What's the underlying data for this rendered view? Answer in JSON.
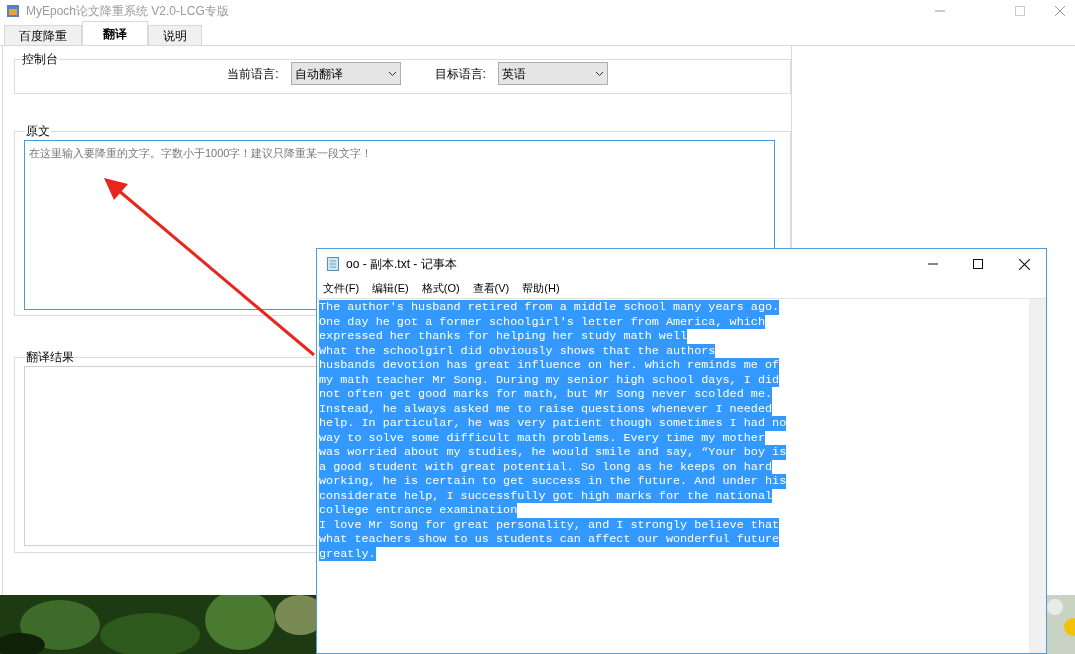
{
  "app_window": {
    "title": "MyEpoch论文降重系统 V2.0-LCG专版",
    "tabs": [
      {
        "label": "百度降重",
        "selected": false
      },
      {
        "label": "翻译",
        "selected": true
      },
      {
        "label": "说明",
        "selected": false
      }
    ],
    "console": {
      "title": "控制台",
      "source_language": {
        "label": "当前语言:",
        "value": "自动翻译"
      },
      "target_language": {
        "label": "目标语言:",
        "value": "英语"
      }
    },
    "source": {
      "title": "原文",
      "placeholder": "在这里输入要降重的文字。字数小于1000字！建议只降重某一段文字！"
    },
    "result": {
      "title": "翻译结果"
    }
  },
  "notepad": {
    "title": "oo - 副本.txt - 记事本",
    "menu": [
      "文件(F)",
      "编辑(E)",
      "格式(O)",
      "查看(V)",
      "帮助(H)"
    ],
    "selected": true,
    "lines": [
      "The author's husband retired from a middle school many years ago.",
      "One day he got a former schoolgirl's letter from America, which",
      "expressed her thanks for helping her study math well",
      "What the schoolgirl did obviously shows that the authors",
      "husbands devotion has great influence on her. which reminds me of",
      "my math teacher Mr Song. During my senior high school days, I did",
      "not often get good marks for math, but Mr Song never scolded me.",
      "Instead, he always asked me to raise questions whenever I needed",
      "help. In particular, he was very patient though sometimes I had no",
      "way to solve some difficult math problems. Every time my mother",
      "was worried about my studies, he would smile and say, “Your boy is",
      "a good student with great potential. So long as he keeps on hard",
      "working, he is certain to get success in the future. And under his",
      "considerate help, I successfully got high marks for the national",
      "college entrance examination",
      "I love Mr Song for great personality, and I strongly believe that",
      "what teachers show to us students can affect our wonderful future",
      "greatly."
    ]
  }
}
